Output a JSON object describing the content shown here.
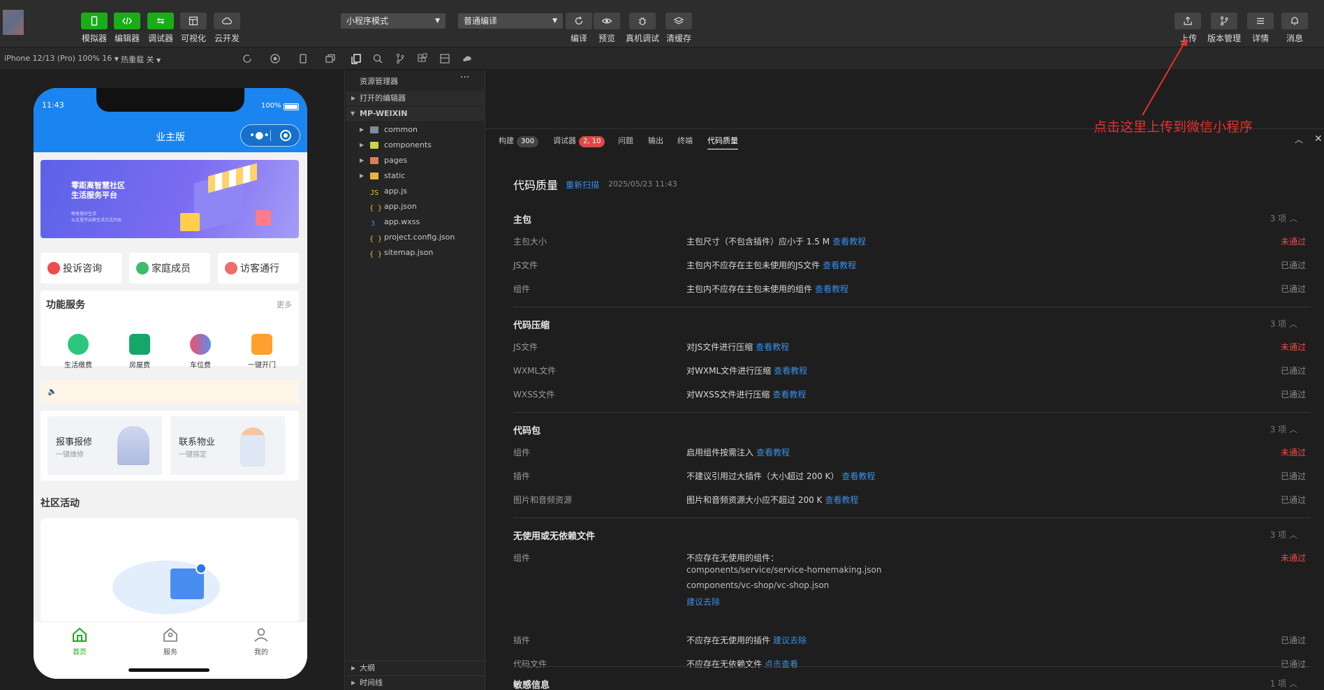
{
  "toolbar": {
    "left_buttons": [
      "模拟器",
      "编辑器",
      "调试器",
      "可视化",
      "云开发"
    ],
    "mode_select": "小程序模式",
    "compile_select": "普通编译",
    "center_buttons": [
      "编译",
      "预览",
      "真机调试",
      "清缓存"
    ],
    "right_buttons": [
      "上传",
      "版本管理",
      "详情",
      "消息"
    ]
  },
  "subbar": {
    "device": "iPhone 12/13 (Pro) 100% 16",
    "hot_reload": "热重载 关"
  },
  "phone": {
    "time": "11:43",
    "battery": "100%",
    "title": "业主版",
    "banner_line1": "零距离智慧社区",
    "banner_line2": "生活服务平台",
    "banner_sub1": "畅享美好生活",
    "banner_sub2": "从这里开启新生活方式开始",
    "quick": [
      "投诉咨询",
      "家庭成员",
      "访客通行"
    ],
    "services_title": "功能服务",
    "more": "更多",
    "services": [
      "生活缴费",
      "房屋费",
      "车位费",
      "一键开门"
    ],
    "repair_title": "报事报修",
    "repair_sub": "一键维修",
    "contact_title": "联系物业",
    "contact_sub": "一键搞定",
    "community_title": "社区活动",
    "tabs": [
      "首页",
      "服务",
      "我的"
    ]
  },
  "explorer": {
    "title": "资源管理器",
    "open_editors": "打开的编辑器",
    "project": "MP-WEIXIN",
    "folders": [
      "common",
      "components",
      "pages",
      "static"
    ],
    "files": [
      "app.js",
      "app.json",
      "app.wxss",
      "project.config.json",
      "sitemap.json"
    ],
    "outline": "大纲",
    "timeline": "时间线"
  },
  "panel": {
    "tabs": [
      "构建",
      "调试器",
      "问题",
      "输出",
      "终端",
      "代码质量"
    ],
    "build_badge": "300",
    "debug_badge": "2, 10",
    "title": "代码质量",
    "rescan": "重新扫描",
    "datetime": "2025/05/23 11:43",
    "annotation": "点击这里上传到微信小程序",
    "sections": [
      {
        "title": "主包",
        "count": "3 项",
        "rows": [
          {
            "label": "主包大小",
            "desc": "主包尺寸（不包含插件）应小于 1.5 M",
            "link": "查看教程",
            "status": "未通过",
            "ok": false
          },
          {
            "label": "JS文件",
            "desc": "主包内不应存在主包未使用的JS文件",
            "link": "查看教程",
            "status": "已通过",
            "ok": true
          },
          {
            "label": "组件",
            "desc": "主包内不应存在主包未使用的组件",
            "link": "查看教程",
            "status": "已通过",
            "ok": true
          }
        ]
      },
      {
        "title": "代码压缩",
        "count": "3 项",
        "rows": [
          {
            "label": "JS文件",
            "desc": "对JS文件进行压缩",
            "link": "查看教程",
            "status": "未通过",
            "ok": false
          },
          {
            "label": "WXML文件",
            "desc": "对WXML文件进行压缩",
            "link": "查看教程",
            "status": "已通过",
            "ok": true
          },
          {
            "label": "WXSS文件",
            "desc": "对WXSS文件进行压缩",
            "link": "查看教程",
            "status": "已通过",
            "ok": true
          }
        ]
      },
      {
        "title": "代码包",
        "count": "3 项",
        "rows": [
          {
            "label": "组件",
            "desc": "启用组件按需注入",
            "link": "查看教程",
            "status": "未通过",
            "ok": false
          },
          {
            "label": "插件",
            "desc": "不建议引用过大插件（大小超过 200 K）",
            "link": "查看教程",
            "status": "已通过",
            "ok": true
          },
          {
            "label": "图片和音频资源",
            "desc": "图片和音频资源大小应不超过 200 K",
            "link": "查看教程",
            "status": "已通过",
            "ok": true
          }
        ]
      },
      {
        "title": "无使用或无依赖文件",
        "count": "3 项",
        "rows": [
          {
            "label": "组件",
            "desc": "不应存在无使用的组件：",
            "extra": [
              "components/service/service-homemaking.json",
              "components/vc-shop/vc-shop.json"
            ],
            "link": "建议去除",
            "status": "未通过",
            "ok": false
          },
          {
            "label": "插件",
            "desc": "不应存在无使用的插件",
            "link": "建议去除",
            "status": "已通过",
            "ok": true
          },
          {
            "label": "代码文件",
            "desc": "不应存在无依赖文件",
            "link": "点击查看",
            "status": "已通过",
            "ok": true
          }
        ]
      },
      {
        "title": "敏感信息",
        "count": "1 项",
        "rows": []
      }
    ]
  }
}
